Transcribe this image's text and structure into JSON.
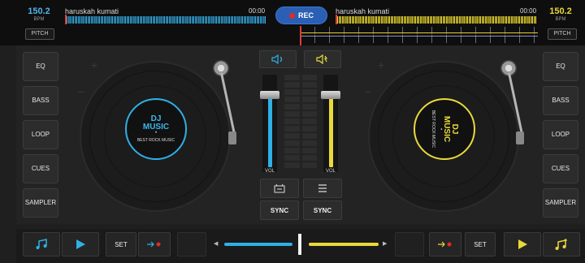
{
  "deck_a": {
    "bpm": "150.2",
    "bpm_label": "BPM",
    "pitch_label": "PITCH",
    "track_name": "haruskah kumati",
    "time": "00:00",
    "disc_title_1": "DJ",
    "disc_title_2": "MUSIC",
    "disc_subtitle": "BEST ROCK MUSIC",
    "side_buttons": [
      "EQ",
      "BASS",
      "LOOP",
      "CUES",
      "SAMPLER"
    ],
    "set_label": "SET",
    "accent": "#2fb0e6"
  },
  "deck_b": {
    "bpm": "150.2",
    "bpm_label": "BPM",
    "pitch_label": "PITCH",
    "track_name": "haruskah kumati",
    "time": "00:00",
    "disc_title_1": "DJ",
    "disc_title_2": "MUSIC",
    "disc_subtitle": "BEST ROCK MUSIC",
    "side_buttons": [
      "EQ",
      "BASS",
      "LOOP",
      "CUES",
      "SAMPLER"
    ],
    "set_label": "SET",
    "accent": "#e8d93a"
  },
  "record": {
    "label": "REC",
    "active_color": "#e22a2a"
  },
  "mixer": {
    "vol_label_left": "VOL",
    "vol_label_right": "VOL",
    "sync_left": "SYNC",
    "sync_right": "SYNC",
    "vol_left_level": 0.85,
    "vol_right_level": 0.85
  },
  "crossfader": {
    "position": 0.5
  },
  "icons": {
    "fx_left": "speaker-fx-icon",
    "fx_right": "speaker-fx-icon",
    "sampler_pad": "pad-icon",
    "menu": "menu-icon",
    "music": "music-note-icon",
    "play": "play-icon",
    "cue_arrow": "arrow-to-dot-icon"
  }
}
